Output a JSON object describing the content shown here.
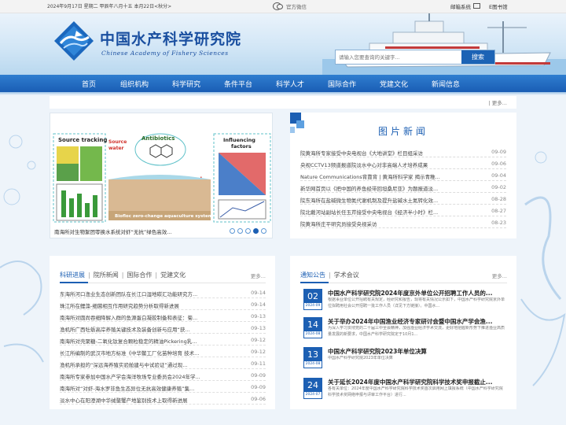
{
  "topbar": {
    "date": "2024年9月17日 星期二 甲辰年八月十五 本月22日<秋分>",
    "wechat_label": "官方微信",
    "email_label": "邮箱系统",
    "ebook_label": "E图书馆"
  },
  "header": {
    "cn_name": "中国水产科学研究院",
    "en_name": "Chinese Academy of Fishery Sciences",
    "search_placeholder": "请输入您要查询的关键字...",
    "search_button": "搜索"
  },
  "nav": [
    "首页",
    "组织机构",
    "科学研究",
    "条件平台",
    "科学人才",
    "国际合作",
    "党建文化",
    "新闻信息"
  ],
  "notice_more": "| 更多...",
  "slider": {
    "caption": "南海所对生物絮团零换水系统对虾“无抗”绿色高效...",
    "dots": 5,
    "active_dot": 3,
    "figure": {
      "source_tracking": "Source tracking",
      "source_water": "Source\nwater",
      "antibiotics": "Antibiotics",
      "feed": "Feed",
      "influencing": "Influencing\nfactors",
      "bottom": "Biofloc zero-change aquaculture system"
    }
  },
  "pic_news": {
    "title": "图片新闻",
    "items": [
      {
        "title": "院黄海所专家接受中央电视台《大地讲堂》栏目组采访",
        "date": "09-09"
      },
      {
        "title": "央视CCTV13频道报道院淡水中心对非高端人才培养成果",
        "date": "09-06"
      },
      {
        "title": "Nature Communications背靠背 | 黄海所科学家 揭示青稚...",
        "date": "09-04"
      },
      {
        "title": "新华网首页以《把中国的养鱼经带回坦桑尼亚》为题报道淡...",
        "date": "09-02"
      },
      {
        "title": "院东海所在盐碱微生物氮代谢机制及提升盐碱水土氮转化效...",
        "date": "08-28"
      },
      {
        "title": "院北戴河站副站长任玉芹接受中央电视台《经济半小时》栏...",
        "date": "08-27"
      },
      {
        "title": "院黄海所庄平研究员接受央视采访",
        "date": "08-23"
      }
    ]
  },
  "sci": {
    "tabs": [
      "科研进展",
      "院所新闻",
      "国际合作",
      "党建文化"
    ],
    "more": "更多...",
    "items": [
      {
        "title": "东海所河口渔业生态创新团队在长江口湿地碳汇功能研究方...",
        "date": "09-14"
      },
      {
        "title": "珠江所在鲤藻-细菌相互作用研究趋势分析取得新进展",
        "date": "09-14"
      },
      {
        "title": "南海所对圆尚吞细降解入群的鱼源蛋白凝胶制备和表征：菊...",
        "date": "09-13"
      },
      {
        "title": "渔机所广西牡蛎高岸养殖关键技术及装备创新与应用“获...",
        "date": "09-13"
      },
      {
        "title": "南海所对壳聚糖-二氧化钛复合颗粒稳定的精油Pickering乳...",
        "date": "09-12"
      },
      {
        "title": "长江所编制的武汉市地方标准《中华鳖工厂化苗种培育 技术...",
        "date": "09-12"
      },
      {
        "title": "渔机所承担的“深远海养殖实验舱建与中试验证”通过现...",
        "date": "09-11"
      },
      {
        "title": "南海所专家参加中国水产学会海洋牧场专业委员会2024年学...",
        "date": "09-09"
      },
      {
        "title": "南海所对“对虾-海水罗非鱼生态异位无抗高效健康养殖”集...",
        "date": "09-09"
      },
      {
        "title": "淡水中心在阳澄湖中华绒螯蟹产地鉴别技术上取得新进展",
        "date": "09-06"
      }
    ]
  },
  "notice2": {
    "tabs": [
      "通知公告",
      "学术会议"
    ],
    "more": "更多...",
    "items": [
      {
        "day": "02",
        "ym": "2024-09",
        "title": "中国水产科学研究院2024年度京外单位公开招聘工作人员的...",
        "desc": "根据事业单位公开招聘有关规定，经研究和报告，现将有关情况公示如下，中国水产科学研究院京外单位拟聘用社会公开招聘一批工作人员（详见下方链接）。中国水..."
      },
      {
        "day": "14",
        "ym": "2024-08",
        "title": "关于举办2024年中国渔业经济专家研讨会暨中国水产学会渔...",
        "desc": "为深入学习贯彻党的二十届三中全会精神，加强渔业经济学术交流，更好地把握新形势下推进渔业高质量发展的新要求，中国水产科学研究院定于10月1..."
      },
      {
        "day": "13",
        "ym": "2024-08",
        "title": "中国水产科学研究院2023年单位决算",
        "desc": "中国水产科学研究院2023年单位决算"
      },
      {
        "day": "24",
        "ym": "2024-07",
        "title": "关于延长2024年度中国水产科学研究院科学技术奖申报截止...",
        "desc": "各有关单位：2024年度中国水产科学研究院科学技术奖首次启用网上填报系统（中国水产科学研究院科学技术奖网络申报与评审工作平台）进行..."
      }
    ]
  }
}
